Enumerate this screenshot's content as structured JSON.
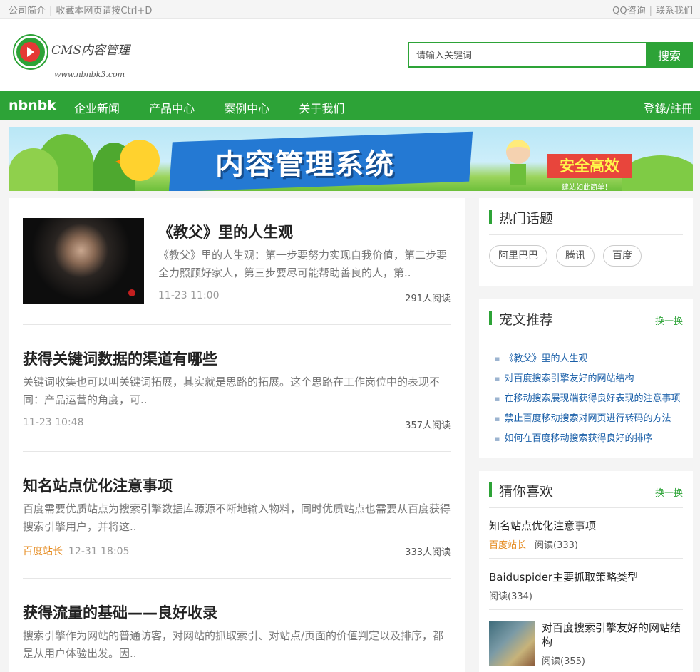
{
  "topbar": {
    "about": "公司简介",
    "bookmark": "收藏本网页请按Ctrl+D",
    "qq": "QQ咨询",
    "contact": "联系我们"
  },
  "logo": {
    "title": "CMS内容管理",
    "url": "www.nbnbk3.com"
  },
  "search": {
    "placeholder": "请输入关键词",
    "button": "搜索"
  },
  "nav": {
    "brand": "nbnbk",
    "items": [
      "企业新闻",
      "产品中心",
      "案例中心",
      "关于我们"
    ],
    "login": "登錄/註冊"
  },
  "banner": {
    "headline": "内容管理系统",
    "badge": "安全高效",
    "slogan": "建站如此简单！"
  },
  "articles": [
    {
      "title": "《教父》里的人生观",
      "summary": "《教父》里的人生观：第一步要努力实现自我价值，第二步要全力照顾好家人，第三步要尽可能帮助善良的人，第..",
      "date": "11-23 11:00",
      "reads": "291人阅读"
    },
    {
      "title": "获得关键词数据的渠道有哪些",
      "summary": "关键词收集也可以叫关键词拓展，其实就是思路的拓展。这个思路在工作岗位中的表现不同：产品运营的角度，可..",
      "date": "11-23 10:48",
      "reads": "357人阅读"
    },
    {
      "title": "知名站点优化注意事项",
      "summary": "百度需要优质站点为搜索引擎数据库源源不断地输入物料，同时优质站点也需要从百度获得搜索引擎用户，并将这..",
      "source": "百度站长",
      "date": "12-31 18:05",
      "reads": "333人阅读"
    },
    {
      "title": "获得流量的基础——良好收录",
      "summary": "搜索引擎作为网站的普通访客，对网站的抓取索引、对站点/页面的价值判定以及排序，都是从用户体验出发。因.."
    }
  ],
  "hot": {
    "title": "热门话题",
    "tags": [
      "阿里巴巴",
      "腾讯",
      "百度"
    ]
  },
  "recommend": {
    "title": "宠文推荐",
    "more": "换一换",
    "items": [
      "《教父》里的人生观",
      "对百度搜索引擎友好的网站结构",
      "在移动搜索展现端获得良好表现的注意事项",
      "禁止百度移动搜索对网页进行转码的方法",
      "如何在百度移动搜索获得良好的排序"
    ]
  },
  "guess": {
    "title": "猜你喜欢",
    "more": "换一换",
    "items": [
      {
        "title": "知名站点优化注意事项",
        "source": "百度站长",
        "reads": "阅读(333)"
      },
      {
        "title": "Baiduspider主要抓取策略类型",
        "reads": "阅读(334)"
      },
      {
        "title": "对百度搜索引擎友好的网站结构",
        "reads": "阅读(355)"
      }
    ]
  }
}
